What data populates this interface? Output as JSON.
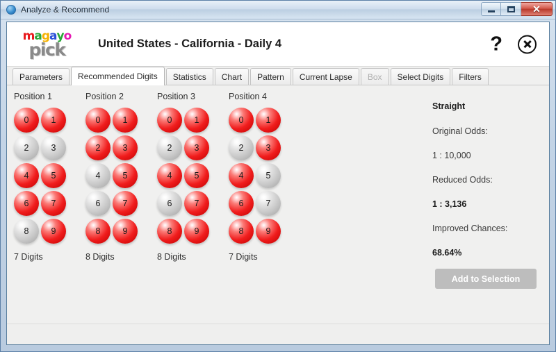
{
  "window": {
    "title": "Analyze & Recommend",
    "icon": "app-circle-icon",
    "minimize_label": "–",
    "maximize_label": "□",
    "close_label": "✕"
  },
  "header": {
    "logo": {
      "top_letters": [
        {
          "char": "m",
          "color": "#e8191c"
        },
        {
          "char": "a",
          "color": "#27a737"
        },
        {
          "char": "g",
          "color": "#f5b200"
        },
        {
          "char": "a",
          "color": "#2a4fd8"
        },
        {
          "char": "y",
          "color": "#27a737"
        },
        {
          "char": "o",
          "color": "#e518b2"
        }
      ],
      "bottom_text": "pick"
    },
    "title": "United States - California - Daily 4",
    "help_label": "?",
    "close_label": "close-icon"
  },
  "tabs": [
    {
      "label": "Parameters",
      "active": false,
      "disabled": false
    },
    {
      "label": "Recommended Digits",
      "active": true,
      "disabled": false
    },
    {
      "label": "Statistics",
      "active": false,
      "disabled": false
    },
    {
      "label": "Chart",
      "active": false,
      "disabled": false
    },
    {
      "label": "Pattern",
      "active": false,
      "disabled": false
    },
    {
      "label": "Current Lapse",
      "active": false,
      "disabled": false
    },
    {
      "label": "Box",
      "active": false,
      "disabled": true
    },
    {
      "label": "Select Digits",
      "active": false,
      "disabled": false
    },
    {
      "label": "Filters",
      "active": false,
      "disabled": false
    }
  ],
  "positions": [
    {
      "heading": "Position 1",
      "digits": [
        {
          "value": "0",
          "selected": true
        },
        {
          "value": "1",
          "selected": true
        },
        {
          "value": "2",
          "selected": false
        },
        {
          "value": "3",
          "selected": false
        },
        {
          "value": "4",
          "selected": true
        },
        {
          "value": "5",
          "selected": true
        },
        {
          "value": "6",
          "selected": true
        },
        {
          "value": "7",
          "selected": true
        },
        {
          "value": "8",
          "selected": false
        },
        {
          "value": "9",
          "selected": true
        }
      ],
      "count_label": "7 Digits"
    },
    {
      "heading": "Position 2",
      "digits": [
        {
          "value": "0",
          "selected": true
        },
        {
          "value": "1",
          "selected": true
        },
        {
          "value": "2",
          "selected": true
        },
        {
          "value": "3",
          "selected": true
        },
        {
          "value": "4",
          "selected": false
        },
        {
          "value": "5",
          "selected": true
        },
        {
          "value": "6",
          "selected": false
        },
        {
          "value": "7",
          "selected": true
        },
        {
          "value": "8",
          "selected": true
        },
        {
          "value": "9",
          "selected": true
        }
      ],
      "count_label": "8 Digits"
    },
    {
      "heading": "Position 3",
      "digits": [
        {
          "value": "0",
          "selected": true
        },
        {
          "value": "1",
          "selected": true
        },
        {
          "value": "2",
          "selected": false
        },
        {
          "value": "3",
          "selected": true
        },
        {
          "value": "4",
          "selected": true
        },
        {
          "value": "5",
          "selected": true
        },
        {
          "value": "6",
          "selected": false
        },
        {
          "value": "7",
          "selected": true
        },
        {
          "value": "8",
          "selected": true
        },
        {
          "value": "9",
          "selected": true
        }
      ],
      "count_label": "8 Digits"
    },
    {
      "heading": "Position 4",
      "digits": [
        {
          "value": "0",
          "selected": true
        },
        {
          "value": "1",
          "selected": true
        },
        {
          "value": "2",
          "selected": false
        },
        {
          "value": "3",
          "selected": true
        },
        {
          "value": "4",
          "selected": true
        },
        {
          "value": "5",
          "selected": false
        },
        {
          "value": "6",
          "selected": true
        },
        {
          "value": "7",
          "selected": false
        },
        {
          "value": "8",
          "selected": true
        },
        {
          "value": "9",
          "selected": true
        }
      ],
      "count_label": "7 Digits"
    }
  ],
  "info": {
    "play_type": "Straight",
    "original_odds_label": "Original Odds:",
    "original_odds_value": "1 : 10,000",
    "reduced_odds_label": "Reduced Odds:",
    "reduced_odds_value": "1 : 3,136",
    "improved_chances_label": "Improved Chances:",
    "improved_chances_value": "68.64%"
  },
  "actions": {
    "add_to_selection": "Add to Selection"
  },
  "colors": {
    "ball_selected": "#f01d1d",
    "ball_unselected": "#c6c6c6",
    "window_border": "#5a7f9e",
    "pane_bg": "#f0f0ef"
  }
}
